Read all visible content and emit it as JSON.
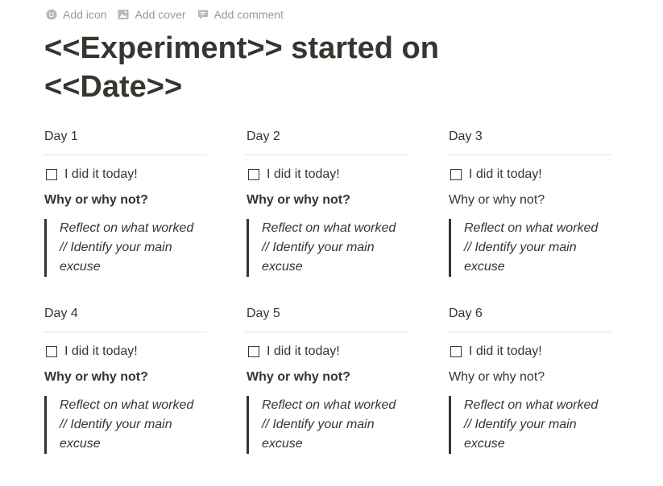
{
  "header": {
    "add_icon": "Add icon",
    "add_cover": "Add cover",
    "add_comment": "Add comment"
  },
  "title": "<<Experiment>> started on <<Date>>",
  "days": [
    {
      "label": "Day 1",
      "todo": "I did it today!",
      "why": "Why or why not?",
      "why_bold": true,
      "quote": "Reflect on what worked // Identify your main excuse"
    },
    {
      "label": "Day 2",
      "todo": "I did it today!",
      "why": "Why or why not?",
      "why_bold": true,
      "quote": "Reflect on what worked // Identify your main excuse"
    },
    {
      "label": "Day 3",
      "todo": "I did it today!",
      "why": "Why or why not?",
      "why_bold": false,
      "quote": "Reflect on what worked // Identify your main excuse"
    },
    {
      "label": "Day 4",
      "todo": "I did it today!",
      "why": "Why or why not?",
      "why_bold": true,
      "quote": "Reflect on what worked // Identify your main excuse"
    },
    {
      "label": "Day 5",
      "todo": "I did it today!",
      "why": "Why or why not?",
      "why_bold": true,
      "quote": "Reflect on what worked // Identify your main excuse"
    },
    {
      "label": "Day 6",
      "todo": "I did it today!",
      "why": "Why or why not?",
      "why_bold": false,
      "quote": "Reflect on what worked // Identify your main excuse"
    }
  ]
}
